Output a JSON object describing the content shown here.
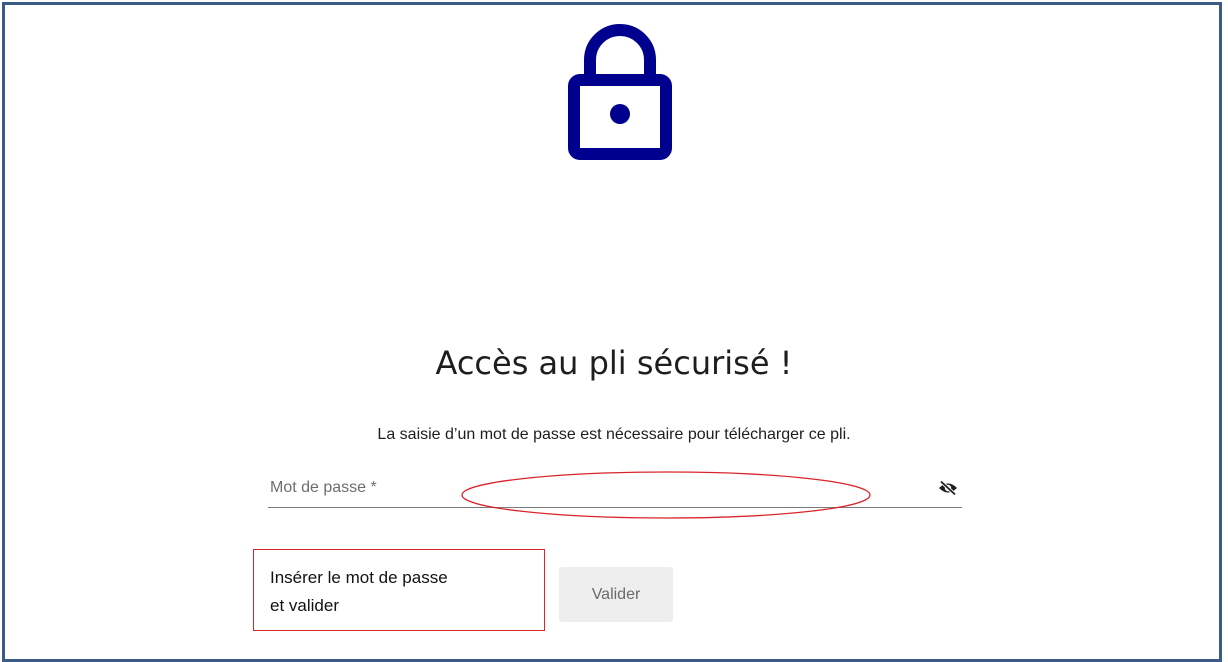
{
  "page": {
    "title": "Accès au pli sécurisé !",
    "subtitle": "La saisie d’un mot de passe est nécessaire pour télécharger ce pli."
  },
  "password_field": {
    "label": "Mot de passe *",
    "value": "",
    "toggle_icon": "eye-slash-icon"
  },
  "annotation": {
    "line1": "Insérer le mot de passe",
    "line2": "et valider"
  },
  "actions": {
    "validate_label": "Valider"
  },
  "colors": {
    "frame_border": "#3c5a88",
    "lock_icon": "#00008f",
    "annotation_red": "#d9262b",
    "button_bg": "#eeeeee"
  },
  "icons": {
    "lock": "lock-icon"
  }
}
